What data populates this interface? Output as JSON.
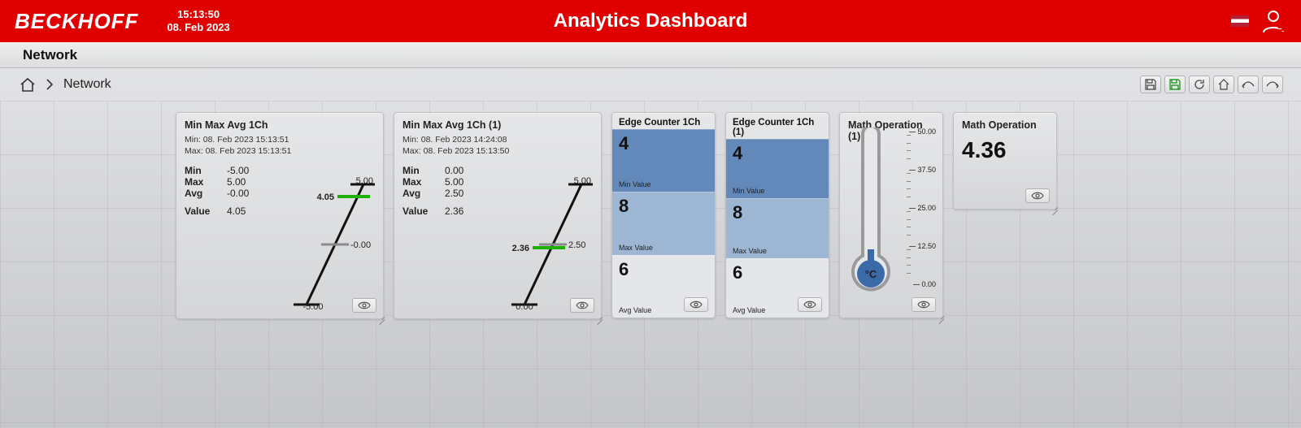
{
  "header": {
    "brand": "BECKHOFF",
    "time": "15:13:50",
    "date": "08. Feb 2023",
    "title": "Analytics Dashboard"
  },
  "page": {
    "title": "Network",
    "breadcrumb": "Network"
  },
  "widgets": {
    "mma1": {
      "title": "Min Max Avg 1Ch",
      "min_ts": "Min:  08. Feb 2023 15:13:51",
      "max_ts": "Max: 08. Feb 2023 15:13:51",
      "min_lbl": "Min",
      "min_val": "-5.00",
      "max_lbl": "Max",
      "max_val": "5.00",
      "avg_lbl": "Avg",
      "avg_val": "-0.00",
      "val_lbl": "Value",
      "val_val": "4.05",
      "chart": {
        "top": "5.00",
        "mid": "-0.00",
        "bot": "-5.00",
        "marker": "4.05"
      }
    },
    "mma2": {
      "title": "Min Max Avg 1Ch (1)",
      "min_ts": "Min:  08. Feb 2023 14:24:08",
      "max_ts": "Max: 08. Feb 2023 15:13:50",
      "min_lbl": "Min",
      "min_val": "0.00",
      "max_lbl": "Max",
      "max_val": "5.00",
      "avg_lbl": "Avg",
      "avg_val": "2.50",
      "val_lbl": "Value",
      "val_val": "2.36",
      "chart": {
        "top": "5.00",
        "mid": "2.50",
        "bot": "0.00",
        "marker": "2.36"
      }
    },
    "edge1": {
      "title": "Edge Counter 1Ch",
      "min": "4",
      "minlbl": "Min Value",
      "max": "8",
      "maxlbl": "Max Value",
      "avg": "6",
      "avglbl": "Avg Value"
    },
    "edge2": {
      "title": "Edge Counter 1Ch (1)",
      "min": "4",
      "minlbl": "Min Value",
      "max": "8",
      "maxlbl": "Max Value",
      "avg": "6",
      "avglbl": "Avg Value"
    },
    "therm": {
      "title": "Math Operation (1)",
      "unit": "°C",
      "scale": [
        "50.00",
        "37.50",
        "25.00",
        "12.50",
        "0.00"
      ]
    },
    "math": {
      "title": "Math Operation",
      "value": "4.36"
    }
  },
  "chart_data": [
    {
      "type": "line",
      "title": "Min Max Avg 1Ch",
      "ylim": [
        -5,
        5
      ],
      "series": [
        {
          "name": "value",
          "values": [
            4.05
          ]
        }
      ],
      "avg": 0.0,
      "min": -5.0,
      "max": 5.0
    },
    {
      "type": "line",
      "title": "Min Max Avg 1Ch (1)",
      "ylim": [
        0,
        5
      ],
      "series": [
        {
          "name": "value",
          "values": [
            2.36
          ]
        }
      ],
      "avg": 2.5,
      "min": 0.0,
      "max": 5.0
    }
  ]
}
